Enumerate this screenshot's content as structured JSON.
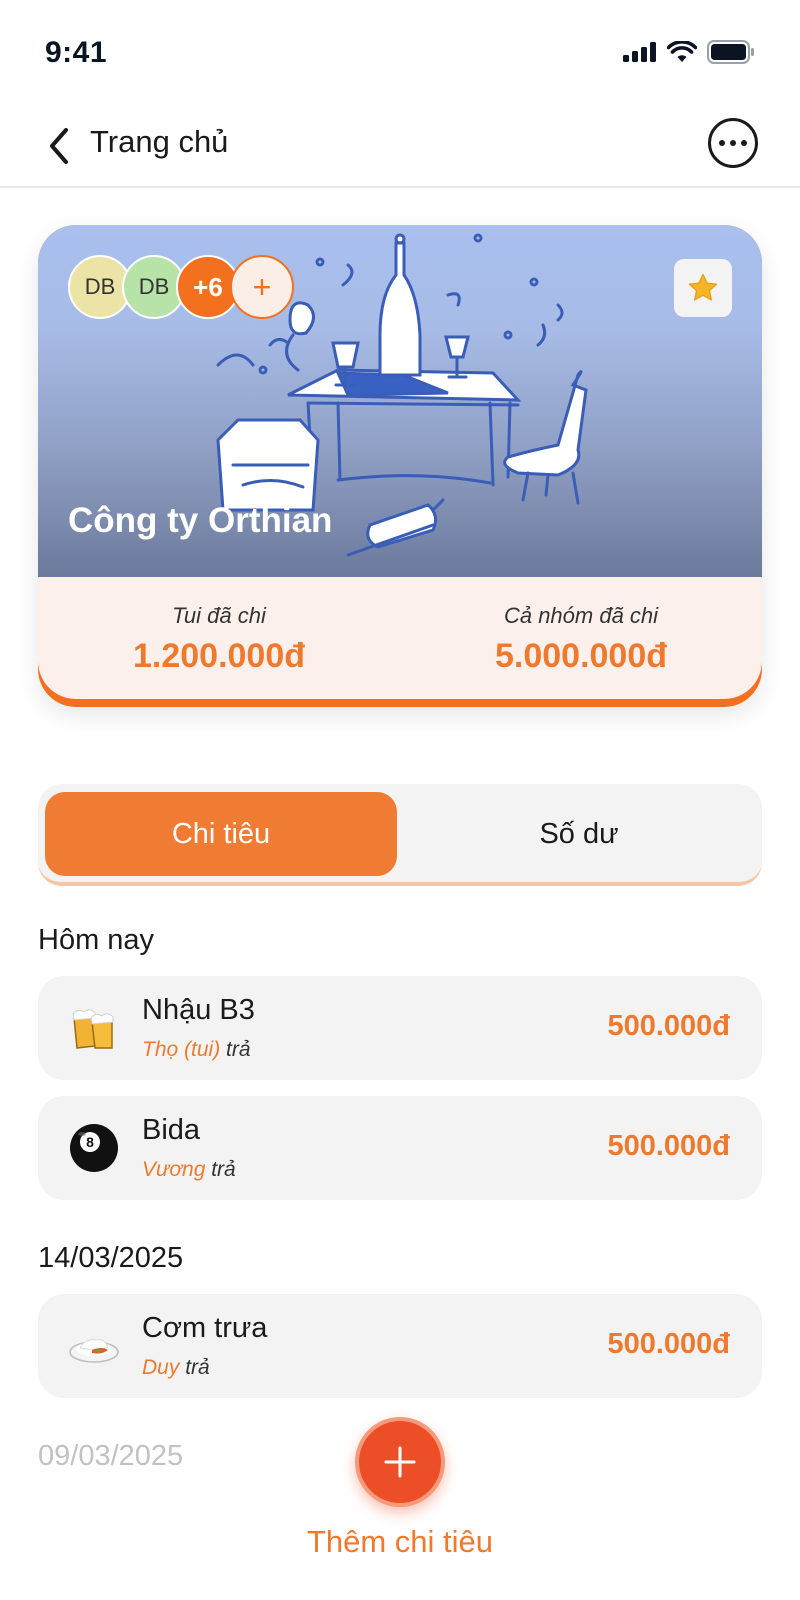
{
  "status_bar": {
    "time": "9:41"
  },
  "nav": {
    "back_label": "Trang chủ"
  },
  "group": {
    "name": "Công ty Orthian",
    "members": [
      "DB",
      "DB"
    ],
    "more_members": "+6",
    "add_member": "+",
    "my_spent_label": "Tui đã chi",
    "my_spent_value": "1.200.000đ",
    "group_spent_label": "Cả nhóm đã chi",
    "group_spent_value": "5.000.000đ"
  },
  "tabs": {
    "expenses": "Chi tiêu",
    "balance": "Số dư"
  },
  "sections": {
    "today": "Hôm nay",
    "date1": "14/03/2025",
    "date2": "09/03/2025"
  },
  "expenses": [
    {
      "icon": "beer-icon",
      "name": "Nhậu B3",
      "payer": "Thọ (tui)",
      "paid_suffix": "trả",
      "amount": "500.000đ"
    },
    {
      "icon": "billiard-ball-icon",
      "name": "Bida",
      "payer": "Vương",
      "paid_suffix": "trả",
      "amount": "500.000đ"
    },
    {
      "icon": "rice-dish-icon",
      "name": "Cơm trưa",
      "payer": "Duy",
      "paid_suffix": "trả",
      "amount": "500.000đ"
    }
  ],
  "fab": {
    "icon": "plus-icon",
    "label": "Thêm chi tiêu"
  },
  "colors": {
    "accent": "#f07c34",
    "fab": "#ec4e28",
    "card_bg": "#fbf0ec"
  }
}
